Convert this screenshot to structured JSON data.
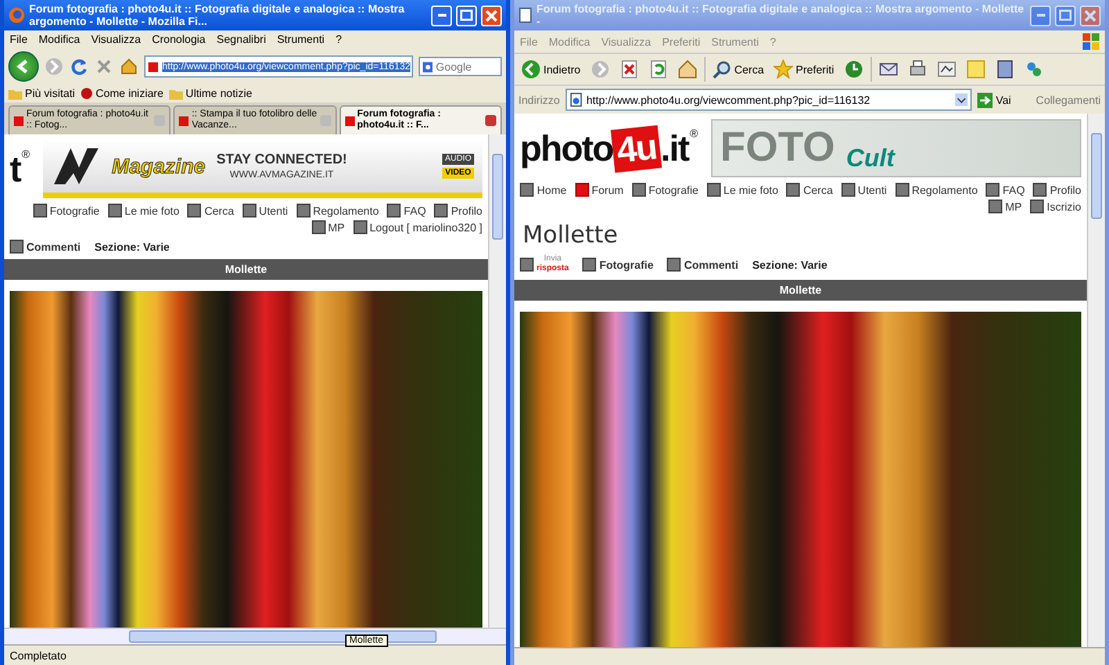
{
  "firefox": {
    "title": "Forum fotografia : photo4u.it :: Fotografia digitale e analogica :: Mostra argomento - Mollette - Mozilla Fi...",
    "menu": [
      "File",
      "Modifica",
      "Visualizza",
      "Cronologia",
      "Segnalibri",
      "Strumenti",
      "?"
    ],
    "url": "http://www.photo4u.org/viewcomment.php?pic_id=116132",
    "search_placeholder": "Google",
    "bookmarks": [
      {
        "label": "Più visitati",
        "kind": "folder"
      },
      {
        "label": "Come iniziare",
        "kind": "site"
      },
      {
        "label": "Ultime notizie",
        "kind": "folder"
      }
    ],
    "tabs": [
      {
        "label": "Forum fotografia : photo4u.it :: Fotog...",
        "selected": false
      },
      {
        "label": ":: Stampa il tuo fotolibro delle Vacanze...",
        "selected": false
      },
      {
        "label": "Forum fotografia : photo4u.it :: F...",
        "selected": true
      }
    ],
    "page": {
      "logo": {
        "parts": [
          {
            "text": "t",
            "kind": "plain"
          }
        ],
        "mark": "®"
      },
      "banner": {
        "kind": "avmagazine",
        "texts": [
          {
            "text": "Magazine",
            "kind": "brand"
          },
          {
            "text": "STAY CONNECTED!",
            "kind": "headline"
          },
          {
            "text": "WWW.AVMAGAZINE.IT",
            "kind": "url"
          },
          {
            "text": "AUDIO",
            "kind": "tag"
          },
          {
            "text": "VIDEO",
            "kind": "label"
          }
        ]
      },
      "nav": [
        "Fotografie",
        "Le mie foto",
        "Cerca",
        "Utenti",
        "Regolamento",
        "FAQ",
        "Profilo",
        "MP",
        "Logout [ mariolino320 ]"
      ],
      "subnav": [
        "Commenti"
      ],
      "section": "Sezione: Varie",
      "bar": "Mollette"
    },
    "status": "Completato",
    "tooltip": "Mollette"
  },
  "ie": {
    "title": "Forum fotografia : photo4u.it :: Fotografia digitale e analogica :: Mostra argomento - Mollette -",
    "menu": [
      "File",
      "Modifica",
      "Visualizza",
      "Preferiti",
      "Strumenti",
      "?"
    ],
    "toolbar": [
      {
        "label": "Indietro",
        "kind": "back"
      },
      {
        "label": "Cerca",
        "kind": "search"
      },
      {
        "label": "Preferiti",
        "kind": "favorites"
      }
    ],
    "address_label": "Indirizzo",
    "url": "http://www.photo4u.org/viewcomment.php?pic_id=116132",
    "go": "Vai",
    "links": "Collegamenti",
    "page": {
      "logo": {
        "parts": [
          {
            "text": "photo",
            "kind": "plain"
          },
          {
            "text": "4u",
            "kind": "box"
          },
          {
            "text": ".it",
            "kind": "plain"
          }
        ],
        "mark": "®"
      },
      "banner": {
        "kind": "fotocult",
        "texts": [
          {
            "text": "FOTO",
            "kind": "title"
          },
          {
            "text": "Cult",
            "kind": "script"
          }
        ]
      },
      "nav": [
        "Home",
        "Forum",
        "Fotografie",
        "Le mie foto",
        "Cerca",
        "Utenti",
        "Regolamento",
        "FAQ",
        "Profilo",
        "MP",
        "Iscrizio"
      ],
      "heading": "Mollette",
      "reply": [
        "Invia",
        "risposta"
      ],
      "subnav": [
        "Fotografie",
        "Commenti"
      ],
      "section": "Sezione: Varie",
      "bar": "Mollette"
    }
  }
}
